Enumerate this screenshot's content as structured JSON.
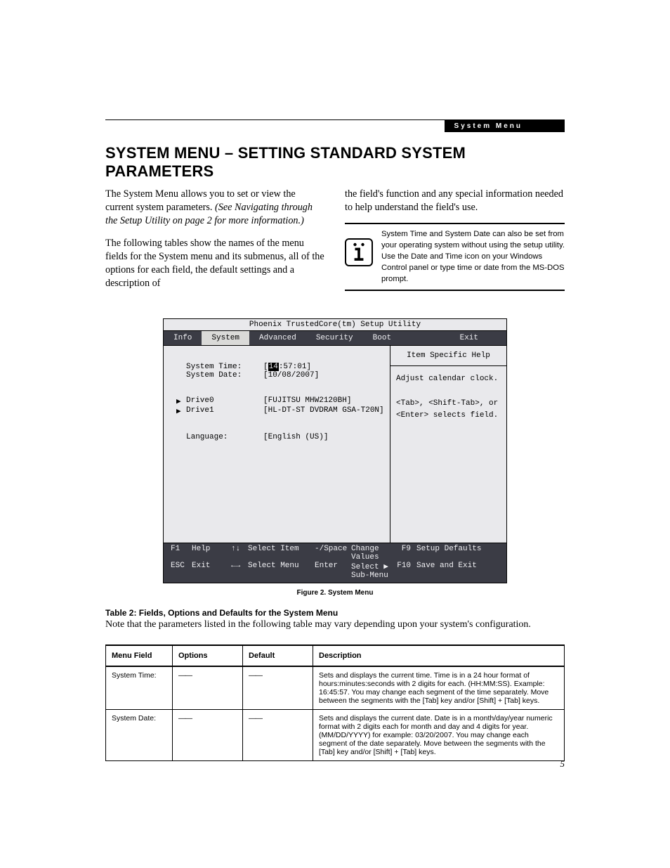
{
  "header": {
    "section_tab": "System Menu"
  },
  "title": "SYSTEM MENU – SETTING STANDARD SYSTEM PARAMETERS",
  "intro": {
    "col1_p1a": "The System Menu allows you to set or view the current system parameters. ",
    "col1_p1b": "(See Navigating through the Setup Utility on page 2 for more information.)",
    "col1_p2": "The following tables show the names of the menu fields for the System menu and its submenus, all of the options for each field, the default settings and a description of",
    "col2_p1": "the field's function and any special information needed to help understand the field's use.",
    "infobox": "System Time and System Date can also be set from your operating system without using the setup utility. Use the Date and Time icon on your Windows Control panel or type time or date from the MS-DOS prompt."
  },
  "bios": {
    "title": "Phoenix TrustedCore(tm) Setup Utility",
    "menu": [
      "Info",
      "System",
      "Advanced",
      "Security",
      "Boot",
      "Exit"
    ],
    "menu_active_index": 1,
    "fields": {
      "time_label": "System Time:",
      "time_value_prefix": "14",
      "time_value_suffix": ":57:01]",
      "date_label": "System Date:",
      "date_value": "[10/08/2007]",
      "drive0_label": "Drive0",
      "drive0_value": "[FUJITSU MHW2120BH]",
      "drive1_label": "Drive1",
      "drive1_value": "[HL-DT-ST DVDRAM GSA-T20N]",
      "lang_label": "Language:",
      "lang_value": "[English (US)]"
    },
    "help": {
      "title": "Item Specific Help",
      "line1": "Adjust calendar clock.",
      "line2": "<Tab>, <Shift-Tab>, or",
      "line3": "<Enter> selects field."
    },
    "footer": {
      "f1_key": "F1",
      "f1_label": "Help",
      "ud_arrows": "↑↓",
      "ud_label": "Select Item",
      "pm_key": "-/Space",
      "pm_label": "Change Values",
      "f9_key": "F9",
      "f9_label": "Setup Defaults",
      "esc_key": "ESC",
      "esc_label": "Exit",
      "lr_arrows": "←→",
      "lr_label": "Select Menu",
      "enter_key": "Enter",
      "enter_label": "Select ▶ Sub-Menu",
      "f10_key": "F10",
      "f10_label": "Save and Exit"
    }
  },
  "figure_caption": "Figure 2.   System Menu",
  "table_title": "Table 2: Fields, Options and Defaults for the System Menu",
  "table_note": "Note that the parameters listed in the following table may vary depending upon your system's configuration.",
  "table": {
    "headers": [
      "Menu Field",
      "Options",
      "Default",
      "Description"
    ],
    "rows": [
      {
        "field": "System Time:",
        "options": "——",
        "default": "——",
        "desc": "Sets and displays the current time. Time is in a 24 hour format of hours:minutes:seconds with 2 digits for each. (HH:MM:SS). Example: 16:45:57. You may change each segment of the time separately. Move between the segments with the [Tab] key and/or [Shift] + [Tab] keys."
      },
      {
        "field": "System Date:",
        "options": "——",
        "default": "——",
        "desc": "Sets and displays the current date. Date is in a month/day/year numeric format with 2 digits each for month and day and 4 digits for year. (MM/DD/YYYY) for example: 03/20/2007. You may change each segment of the date separately. Move between the segments with the [Tab] key and/or [Shift] + [Tab] keys."
      }
    ]
  },
  "page_number": "5"
}
